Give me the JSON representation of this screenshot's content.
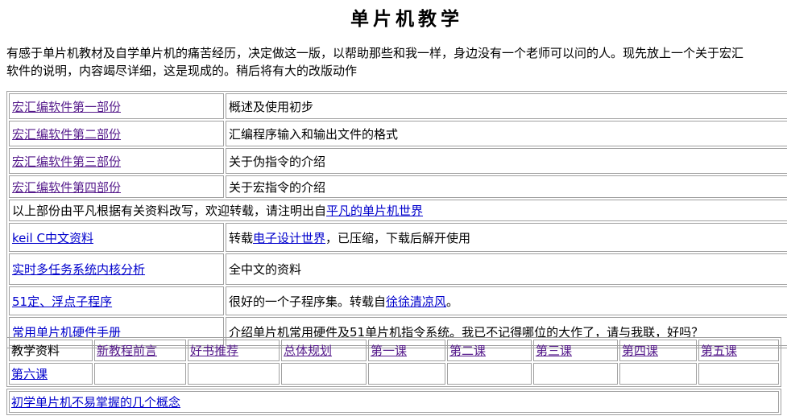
{
  "page": {
    "title": "单片机教学",
    "intro_line1": "有感于单片机教材及自学单片机的痛苦经历，决定做这一版，以帮助那些和我一样，身边没有一个老师可以问的人。现先放上一个关于宏汇",
    "intro_line2": "软件的说明，内容竭尽详细，这是现成的。稍后将有大的改版动作"
  },
  "main_table": {
    "rows": [
      {
        "link": "宏汇编软件第一部份",
        "desc": "概述及使用初步"
      },
      {
        "link": "宏汇编软件第二部份",
        "desc": "汇编程序输入和输出文件的格式"
      },
      {
        "link": "宏汇编软件第三部份",
        "desc": "关于伪指令的介绍"
      },
      {
        "link": "宏汇编软件第四部份",
        "desc": "关于宏指令的介绍"
      }
    ],
    "credit_text": "以上部份由平凡根据有关资料改写，欢迎转载，请注明出自",
    "credit_link": "平凡的单片机世界",
    "keil": {
      "link": "keil C中文资料",
      "desc_pre": "转载",
      "desc_link": "电子设计世界",
      "desc_post": "，已压缩，下载后解开使用"
    },
    "rtos": {
      "link": "实时多任务系统内核分析",
      "desc": "全中文的资料"
    },
    "float": {
      "link": "51定、浮点子程序",
      "desc_pre": "很好的一个子程序集。转载自",
      "desc_link": "徐徐清凉风",
      "desc_post": "。"
    },
    "hw": {
      "link": "常用单片机硬件手册",
      "desc": "介绍单片机常用硬件及51单片机指令系统。我已不记得哪位的大作了，请与我联，好吗？"
    }
  },
  "lessons": {
    "label": "教学资料",
    "row1": [
      "新教程前言",
      "好书推荐",
      "总体规划",
      "第一课",
      "第二课",
      "第三课",
      "第四课",
      "第五课"
    ],
    "row2": [
      "第六课"
    ]
  },
  "concepts": {
    "link": "初学单片机不易掌握的几个概念"
  },
  "colors": {
    "link": "#0000cc",
    "visited": "#551a8b",
    "border": "#a0a0a0"
  }
}
